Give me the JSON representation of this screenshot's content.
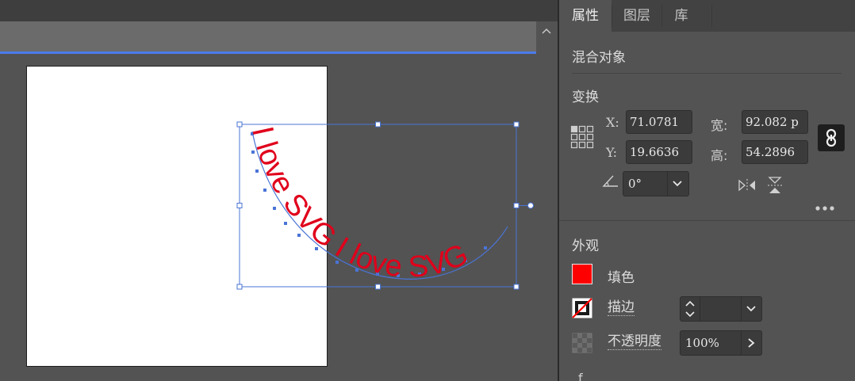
{
  "artwork": {
    "path_text": "I love SVG I love SVG",
    "text_color": "#e0001b",
    "selection_color": "#4a74d6"
  },
  "panel": {
    "tabs": [
      {
        "label": "属性",
        "active": true
      },
      {
        "label": "图层",
        "active": false
      },
      {
        "label": "库",
        "active": false
      }
    ],
    "object_type": "混合对象",
    "transform": {
      "title": "变换",
      "x_label": "X:",
      "x_value": "71.0781",
      "y_label": "Y:",
      "y_value": "19.6636",
      "w_label": "宽:",
      "w_value": "92.082 p",
      "h_label": "高:",
      "h_value": "54.2896",
      "angle_value": "0°"
    },
    "appearance": {
      "title": "外观",
      "fill_label": "填色",
      "fill_color": "#ff0000",
      "stroke_label": "描边",
      "stroke_value": "",
      "opacity_label": "不透明度",
      "opacity_value": "100%"
    },
    "partial_section_glyph": "f"
  },
  "icons": {
    "scroll_up": "chevron-up-icon",
    "reference_point": "reference-point-grid-icon",
    "constrain_proportions": "link-icon",
    "rotate": "angle-icon",
    "flip_horizontal": "flip-horizontal-icon",
    "flip_vertical": "flip-vertical-icon",
    "more_options": "ellipsis-icon",
    "stroke_none": "stroke-none-swatch-icon",
    "opacity": "opacity-checker-icon"
  }
}
